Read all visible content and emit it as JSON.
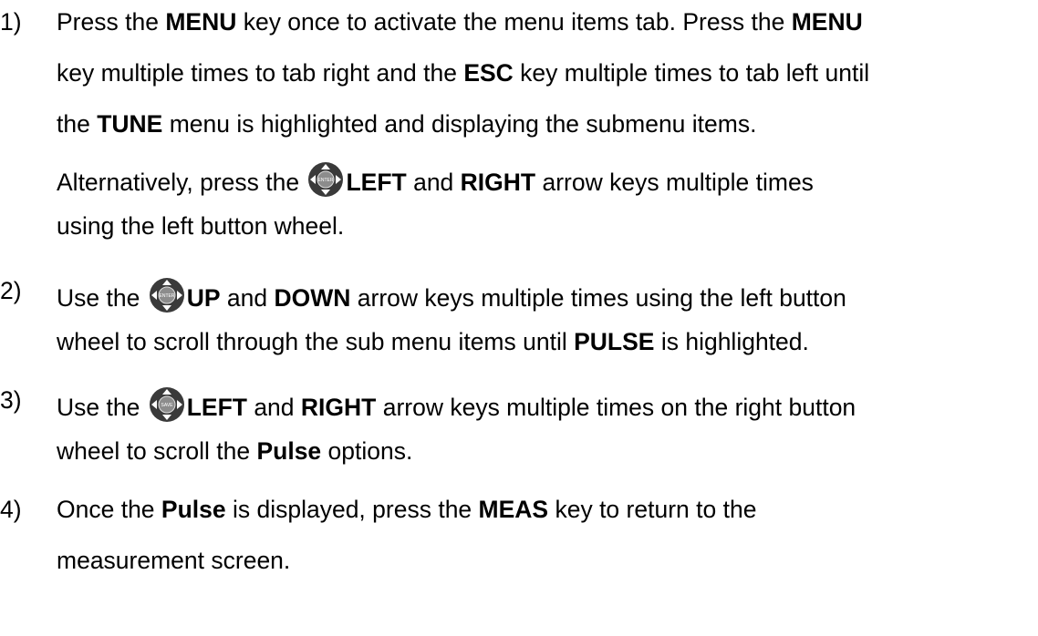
{
  "steps": [
    {
      "num": "1)",
      "l1": {
        "a": "Press the ",
        "b1": "MENU",
        "c": " key once to activate the menu items tab.  Press the ",
        "b2": "MENU"
      },
      "l2": {
        "a": "key multiple times to tab right and the ",
        "b1": "ESC",
        "c": " key multiple times to tab left until"
      },
      "l3": {
        "a": "the ",
        "b1": "TUNE",
        "c": " menu is highlighted and displaying the submenu items."
      },
      "l4": {
        "a": "Alternatively, press the ",
        "icon": "enter-wheel-icon",
        "b1": "LEFT",
        "c": " and ",
        "b2": "RIGHT",
        "d": " arrow keys multiple times"
      },
      "l5": {
        "a": "using the left button wheel."
      }
    },
    {
      "num": "2)",
      "l1": {
        "a": "Use the ",
        "icon": "enter-wheel-icon",
        "b1": "UP",
        "c": " and ",
        "b2": "DOWN",
        "d": " arrow keys multiple times using the left button"
      },
      "l2": {
        "a": "wheel to scroll through the sub menu items until ",
        "b1": "PULSE",
        "c": " is highlighted."
      }
    },
    {
      "num": "3)",
      "l1": {
        "a": "Use the ",
        "icon": "save-wheel-icon",
        "b1": "LEFT",
        "c": " and ",
        "b2": "RIGHT",
        "d": " arrow keys multiple times on the right button"
      },
      "l2": {
        "a": "wheel to scroll the ",
        "b1": "Pulse",
        "c": " options."
      }
    },
    {
      "num": "4)",
      "l1": {
        "a": "Once the ",
        "b1": "Pulse",
        "c": " is displayed, press the ",
        "b2": "MEAS",
        "d": " key to return to the"
      },
      "l2": {
        "a": "measurement screen."
      }
    }
  ],
  "icons": {
    "wheel_body": "#3a3a3a",
    "wheel_center": "#8c8c8c",
    "wheel_text_left": "ENTER",
    "wheel_text_right": "SAVE"
  }
}
